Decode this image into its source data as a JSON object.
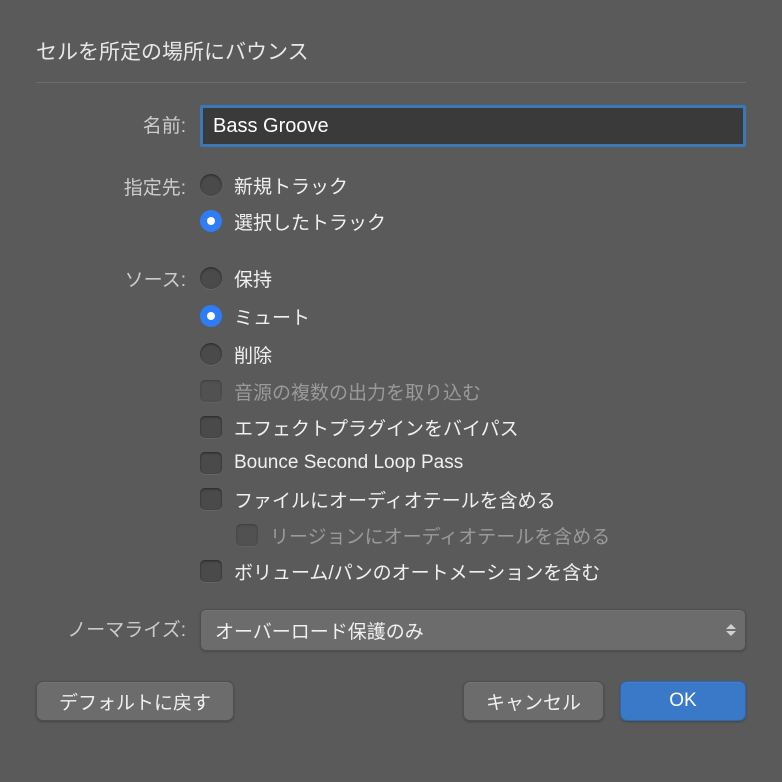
{
  "title": "セルを所定の場所にバウンス",
  "name": {
    "label": "名前:",
    "value": "Bass Groove"
  },
  "destination": {
    "label": "指定先:",
    "options": [
      "新規トラック",
      "選択したトラック"
    ],
    "selected": 1
  },
  "source": {
    "label": "ソース:",
    "options": [
      "保持",
      "ミュート",
      "削除"
    ],
    "selected": 1
  },
  "checks": {
    "multi_out": {
      "label": "音源の複数の出力を取り込む",
      "checked": false,
      "disabled": true
    },
    "bypass_fx": {
      "label": "エフェクトプラグインをバイパス",
      "checked": false,
      "disabled": false
    },
    "second_loop": {
      "label": "Bounce Second Loop Pass",
      "checked": false,
      "disabled": false
    },
    "tail_file": {
      "label": "ファイルにオーディオテールを含める",
      "checked": false,
      "disabled": false
    },
    "tail_region": {
      "label": "リージョンにオーディオテールを含める",
      "checked": false,
      "disabled": true
    },
    "vol_pan": {
      "label": "ボリューム/パンのオートメーションを含む",
      "checked": false,
      "disabled": false
    }
  },
  "normalize": {
    "label": "ノーマライズ:",
    "value": "オーバーロード保護のみ"
  },
  "buttons": {
    "defaults": "デフォルトに戻す",
    "cancel": "キャンセル",
    "ok": "OK"
  }
}
